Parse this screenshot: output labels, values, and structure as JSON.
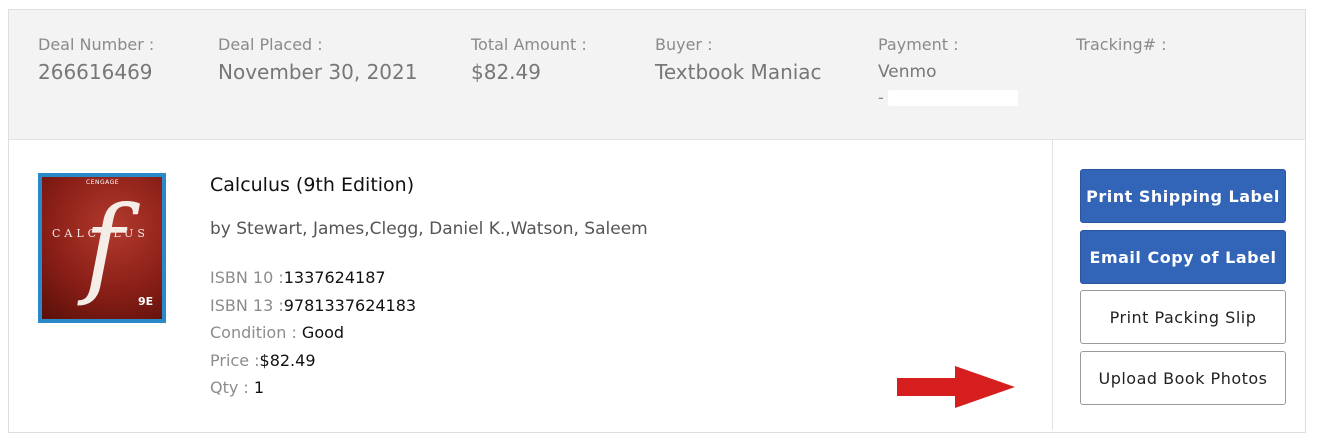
{
  "order_header": {
    "deal_number": {
      "label": "Deal Number :",
      "value": "266616469"
    },
    "deal_placed": {
      "label": "Deal Placed :",
      "value": "November 30, 2021"
    },
    "total_amount": {
      "label": "Total Amount :",
      "value": "$82.49"
    },
    "buyer": {
      "label": "Buyer :",
      "value": "Textbook Maniac"
    },
    "payment": {
      "label": "Payment :",
      "value": "Venmo",
      "account_prefix": "-"
    },
    "tracking": {
      "label": "Tracking# :",
      "value": ""
    }
  },
  "book": {
    "cover": {
      "brand": "CENGAGE",
      "title": "CALCULUS",
      "symbol": "f",
      "edition": "9E"
    },
    "title": "Calculus (9th Edition)",
    "author": "by Stewart, James,Clegg, Daniel K.,Watson, Saleem",
    "details": [
      {
        "label": "ISBN 10 :",
        "value": "1337624187"
      },
      {
        "label": "ISBN 13 :",
        "value": "9781337624183"
      },
      {
        "label": "Condition : ",
        "value": "Good"
      },
      {
        "label": "Price :",
        "value": "$82.49"
      },
      {
        "label": "Qty : ",
        "value": "1"
      }
    ]
  },
  "actions": {
    "print_shipping_label": "Print Shipping Label",
    "email_copy_of_label": "Email Copy of Label",
    "print_packing_slip": "Print Packing Slip",
    "upload_book_photos": "Upload Book Photos"
  },
  "colors": {
    "primary_button": "#3264b8",
    "header_bg": "#f3f3f3",
    "arrow": "#d61e1e"
  },
  "icons": {
    "annotation": "red-arrow-icon"
  }
}
